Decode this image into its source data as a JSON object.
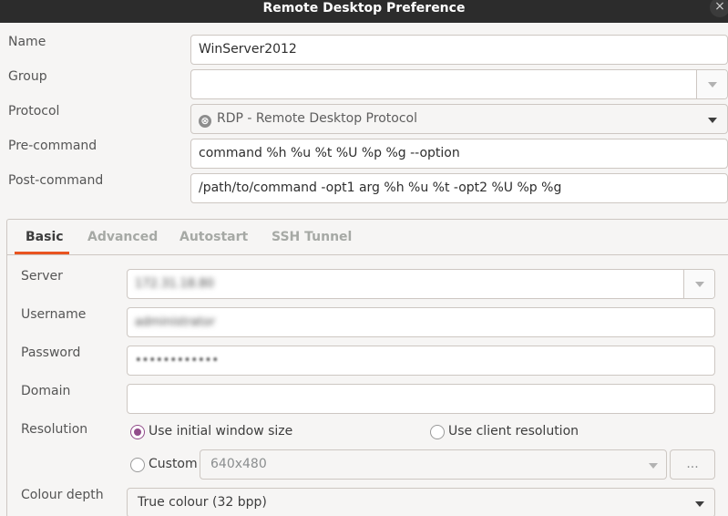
{
  "window": {
    "title": "Remote Desktop Preference",
    "close_glyph": "×"
  },
  "profile": {
    "name_label": "Name",
    "name_value": "WinServer2012",
    "group_label": "Group",
    "group_value": "",
    "protocol_label": "Protocol",
    "protocol_value": "RDP - Remote Desktop Protocol",
    "protocol_icon": "rdp-protocol-icon",
    "precommand_label": "Pre-command",
    "precommand_value": "command %h %u %t %U %p %g --option",
    "postcommand_label": "Post-command",
    "postcommand_value": "/path/to/command -opt1 arg %h %u %t -opt2 %U %p %g"
  },
  "tabs": [
    {
      "label": "Basic",
      "active": true
    },
    {
      "label": "Advanced",
      "active": false
    },
    {
      "label": "Autostart",
      "active": false
    },
    {
      "label": "SSH Tunnel",
      "active": false
    }
  ],
  "basic": {
    "server_label": "Server",
    "server_value": "172.31.18.80",
    "username_label": "Username",
    "username_value": "administrator",
    "password_label": "Password",
    "password_value": "••••••••••••",
    "domain_label": "Domain",
    "domain_value": "",
    "resolution_label": "Resolution",
    "res_initial": "Use initial window size",
    "res_client": "Use client resolution",
    "res_custom": "Custom",
    "res_custom_value": "640x480",
    "res_more": "...",
    "colour_label": "Colour depth",
    "colour_value": "True colour (32 bpp)"
  },
  "colors": {
    "accent": "#e95420",
    "radio_selected": "#924d8b",
    "titlebar": "#2c2c2c"
  }
}
